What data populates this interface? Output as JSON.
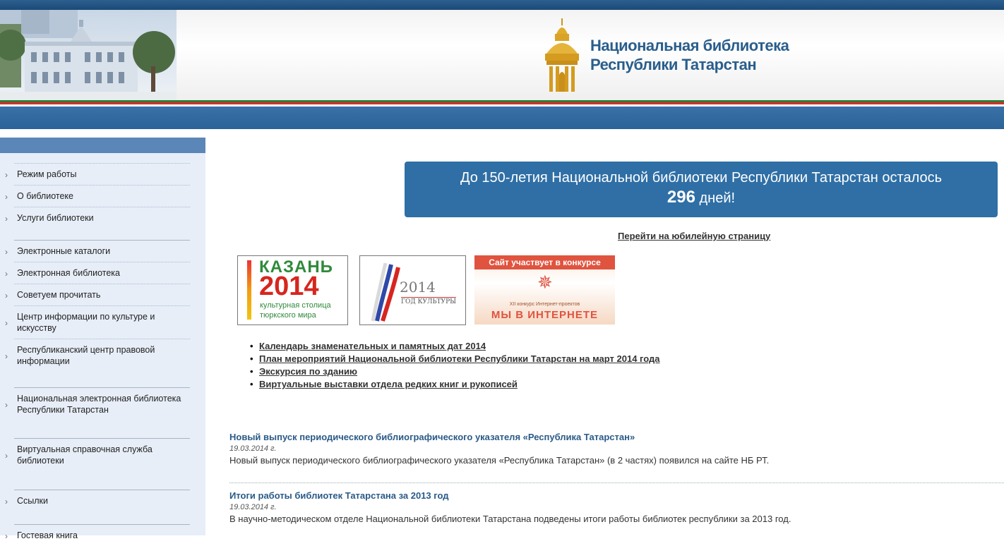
{
  "header": {
    "logo_line1": "Национальная библиотека",
    "logo_line2": "Республики Татарстан"
  },
  "sidebar": {
    "groups": [
      [
        "Режим работы",
        "О библиотеке",
        "Услуги библиотеки"
      ],
      [
        "Электронные каталоги",
        "Электронная библиотека",
        "Советуем прочитать",
        "Центр информации по культуре и искусству",
        "Республиканский центр правовой информации"
      ],
      [
        "Национальная электронная библиотека Республики Татарстан"
      ],
      [
        "Виртуальная справочная служба библиотеки"
      ],
      [
        "Ссылки"
      ],
      [
        "Гостевая книга"
      ]
    ]
  },
  "banner": {
    "line1": "До 150-летия Национальной библиотеки Республики Татарстан осталось",
    "days": "296",
    "days_suffix": " дней!"
  },
  "jubilee_link": "Перейти на юбилейную страницу",
  "ads": {
    "kazan": {
      "word": "КАЗАНЬ",
      "year": "2014",
      "line1": "культурная столица",
      "line2": "тюркского мира"
    },
    "culture": {
      "year": "2014",
      "caption": "ГОД КУЛЬТУРЫ"
    },
    "contest": {
      "top": "Сайт участвует в конкурсе",
      "small": "XII конкурс Интернет-проектов",
      "big": "МЫ В ИНТЕРНЕТЕ"
    }
  },
  "links": [
    "Календарь знаменательных и памятных дат 2014",
    "План мероприятий Национальной библиотеки Республики Татарстан на март 2014 года",
    "Экскурсия по зданию ",
    "Виртуальные выставки отдела редких книг и рукописей"
  ],
  "news": [
    {
      "title": "Новый выпуск периодического библиографического указателя «Республика Татарстан»",
      "date": "19.03.2014 г.",
      "text": "Новый выпуск периодического библиографического указателя «Республика Татарстан» (в 2 частях) появился на сайте НБ РТ."
    },
    {
      "title": "Итоги работы библиотек Татарстана за 2013 год",
      "date": "19.03.2014 г.",
      "text": "В научно-методическом отделе Национальной библиотеки Татарстана подведены итоги работы библиотек республики за 2013 год."
    }
  ]
}
